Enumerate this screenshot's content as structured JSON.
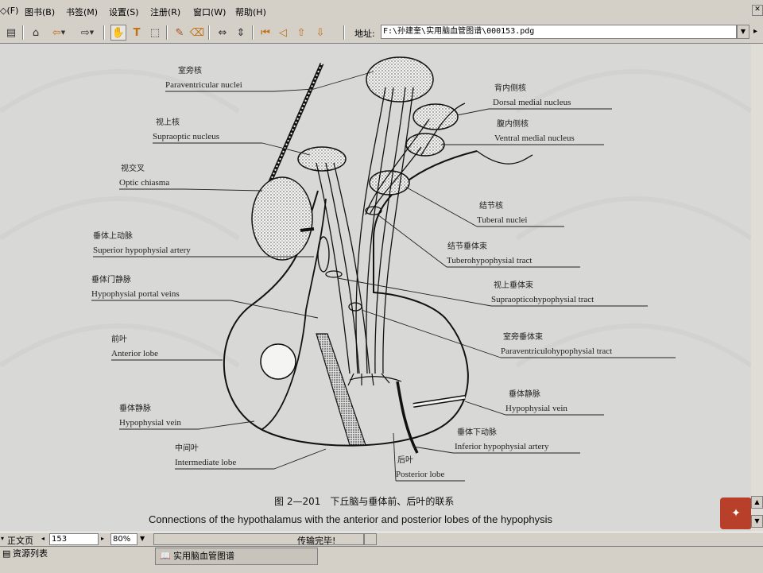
{
  "menu": [
    {
      "label": "◇(F)"
    },
    {
      "label": "图书(B)"
    },
    {
      "label": "书签(M)"
    },
    {
      "label": "设置(S)"
    },
    {
      "label": "注册(R)"
    },
    {
      "label": "窗口(W)"
    },
    {
      "label": "帮助(H)"
    }
  ],
  "toolbar": {
    "address_label": "地址:",
    "address_value": "F:\\孙建奎\\实用脑血管图谱\\000153.pdg",
    "icons": [
      "page-icon",
      "home-icon",
      "back-arrow-icon",
      "forward-arrow-icon",
      "hand-tool-icon",
      "text-tool-icon",
      "select-tool-icon",
      "highlight-icon",
      "eraser-icon",
      "fit-width-icon",
      "fit-height-icon",
      "first-page-icon",
      "prev-page-icon",
      "up-icon",
      "down-icon"
    ]
  },
  "figure": {
    "caption_cn": "图 2—201　下丘脑与垂体前、后叶的联系",
    "caption_en": "Connections of the hypothalamus with the anterior and posterior lobes of the hypophysis",
    "labels_left": [
      {
        "cn": "室旁核",
        "en": "Paraventricular nuclei"
      },
      {
        "cn": "视上核",
        "en": "Supraoptic nucleus"
      },
      {
        "cn": "视交叉",
        "en": "Optic chiasma"
      },
      {
        "cn": "垂体上动脉",
        "en": "Superior hypophysial artery"
      },
      {
        "cn": "垂体门静脉",
        "en": "Hypophysial portal veins"
      },
      {
        "cn": "前叶",
        "en": "Anterior lobe"
      },
      {
        "cn": "垂体静脉",
        "en": "Hypophysial vein"
      },
      {
        "cn": "中间叶",
        "en": "Intermediate lobe"
      }
    ],
    "labels_right": [
      {
        "cn": "背内侧核",
        "en": "Dorsal medial nucleus"
      },
      {
        "cn": "腹内侧核",
        "en": "Ventral medial nucleus"
      },
      {
        "cn": "结节核",
        "en": "Tuberal nuclei"
      },
      {
        "cn": "结节垂体束",
        "en": "Tuberohypophysial tract"
      },
      {
        "cn": "视上垂体束",
        "en": "Supraopticohypophysial tract"
      },
      {
        "cn": "室旁垂体束",
        "en": "Paraventriculohypophysial tract"
      },
      {
        "cn": "垂体静脉",
        "en": "Hypophysial vein"
      },
      {
        "cn": "垂体下动脉",
        "en": "Inferior hypophysial artery"
      },
      {
        "cn": "后叶",
        "en": "Posterior lobe"
      }
    ]
  },
  "status": {
    "page_mode": "正文页",
    "page_number": "153",
    "zoom": "80%",
    "message": "传输完毕!"
  },
  "bottom": {
    "resource_list": "资源列表",
    "task_tab": "实用脑血管图谱"
  }
}
